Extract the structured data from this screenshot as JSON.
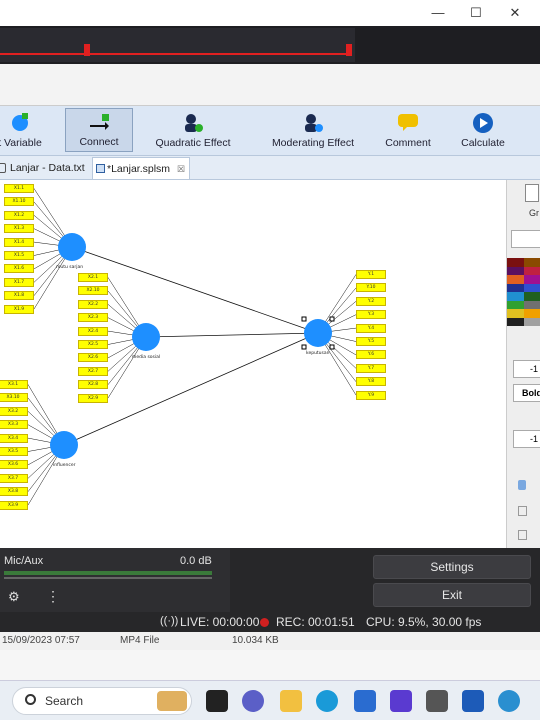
{
  "titlebar": {
    "minimize": "—",
    "maximize": "☐",
    "close": "✕"
  },
  "toolbar": {
    "items": [
      {
        "label": "t Variable"
      },
      {
        "label": "Connect"
      },
      {
        "label": "Quadratic Effect"
      },
      {
        "label": "Moderating Effect"
      },
      {
        "label": "Comment"
      },
      {
        "label": "Calculate"
      }
    ]
  },
  "tabs": [
    {
      "label": "Lanjar - Data.txt"
    },
    {
      "label": "*Lanjar.splsm",
      "close": "☒"
    }
  ],
  "model": {
    "constructs": [
      {
        "label": "mutu sarjan"
      },
      {
        "label": "media sosial"
      },
      {
        "label": "influencer"
      },
      {
        "label": "keputusan"
      }
    ],
    "indicators_x1": [
      "X1.1",
      "X1.10",
      "X1.2",
      "X1.3",
      "X1.4",
      "X1.5",
      "X1.6",
      "X1.7",
      "X1.8",
      "X1.9"
    ],
    "indicators_x2": [
      "X2.1",
      "X2.10",
      "X2.2",
      "X2.3",
      "X2.4",
      "X2.5",
      "X2.6",
      "X2.7",
      "X2.8",
      "X2.9"
    ],
    "indicators_x3": [
      "X3.1",
      "X3.10",
      "X3.2",
      "X3.3",
      "X3.4",
      "X3.5",
      "X3.6",
      "X3.7",
      "X3.8",
      "X3.9"
    ],
    "indicators_y": [
      "Y.1",
      "Y.10",
      "Y.2",
      "Y.3",
      "Y.4",
      "Y.5",
      "Y.6",
      "Y.7",
      "Y.8",
      "Y.9"
    ]
  },
  "rightpanel": {
    "label_gr": "Gr",
    "spin1": "-1",
    "font_style": "Bold",
    "spin2": "-1",
    "colors": [
      "#7a1010",
      "#8a4a00",
      "#5a1060",
      "#c02040",
      "#e06020",
      "#a01090",
      "#203090",
      "#3050d0",
      "#2090d0",
      "#206020",
      "#30a030",
      "#707070",
      "#e0c020",
      "#f0a000",
      "#202020",
      "#a0a0a0"
    ]
  },
  "obs": {
    "mixer_label": "Mic/Aux",
    "mixer_db": "0.0 dB",
    "settings_label": "Settings",
    "exit_label": "Exit",
    "live": "LIVE: 00:00:00",
    "rec": "REC: 00:01:51",
    "cpu": "CPU: 9.5%, 30.00 fps"
  },
  "fileinfo": {
    "date": "15/09/2023 07:57",
    "type": "MP4 File",
    "size": "10.034 KB"
  },
  "taskbar": {
    "search_placeholder": "Search"
  }
}
